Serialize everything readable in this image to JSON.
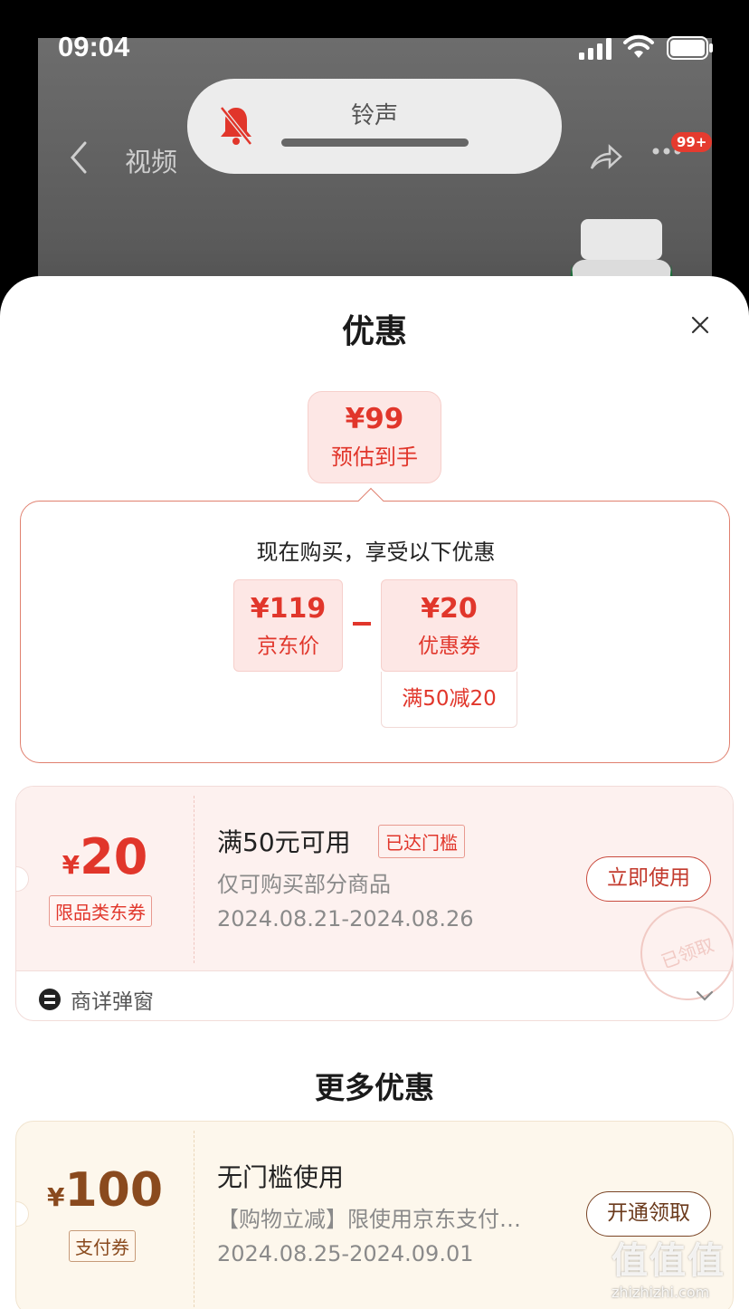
{
  "status_bar": {
    "time": "09:04"
  },
  "background": {
    "nav_title": "视频",
    "badge": "99+"
  },
  "ringer_hud": {
    "label": "铃声",
    "icon": "bell-slash-icon",
    "color": "#e1362b"
  },
  "sheet": {
    "title": "优惠",
    "estimate": {
      "price": "¥99",
      "label": "预估到手"
    },
    "calc": {
      "title": "现在购买，享受以下优惠",
      "jd_price": "¥119",
      "jd_label": "京东价",
      "coupon_price": "¥20",
      "coupon_label": "优惠券",
      "rule": "满50减20"
    },
    "coupon": {
      "currency": "¥",
      "amount": "20",
      "tag": "限品类东券",
      "title": "满50元可用",
      "reach_badge": "已达门槛",
      "desc": "仅可购买部分商品",
      "date": "2024.08.21-2024.08.26",
      "button": "立即使用",
      "stamp": "已领取",
      "footer": "商详弹窗"
    },
    "more_title": "更多优惠",
    "coupon2": {
      "currency": "¥",
      "amount": "100",
      "tag": "支付券",
      "title": "无门槛使用",
      "desc": "【购物立减】限使用京东支付…",
      "date": "2024.08.25-2024.09.01",
      "button": "开通领取"
    }
  },
  "watermark": {
    "logo": "值值值",
    "url": "zhizhizhi.com"
  },
  "colors": {
    "accent": "#e1362b",
    "brown": "#8a4a1e"
  }
}
